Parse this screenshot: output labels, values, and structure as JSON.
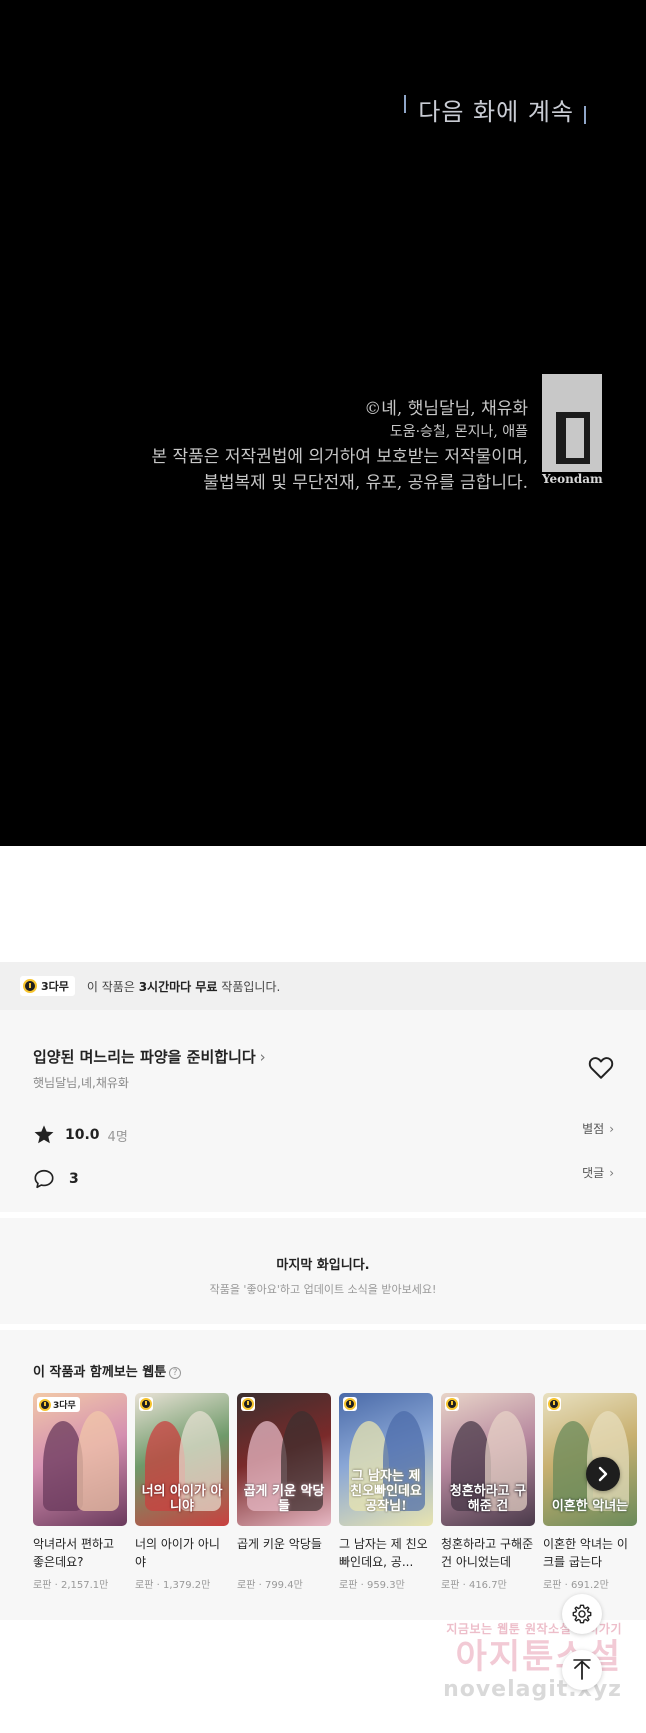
{
  "comic": {
    "to_be_continued": "다음 화에 계속",
    "credit_line1": "©녜, 햇님달님, 채유화",
    "credit_line2": "도움·승칠, 몬지나, 애플",
    "copyright_line1": "본 작품은 저작권법에 의거하여 보호받는 저작물이며,",
    "copyright_line2": "불법복제 및 무단전재, 유포, 공유를 금합니다.",
    "publisher": "Yeondam"
  },
  "free_banner": {
    "badge": "3다무",
    "text_prefix": "이 작품은 ",
    "text_bold": "3시간마다 무료",
    "text_suffix": " 작품입니다."
  },
  "work": {
    "title": "입양된 며느리는 파양을 준비합니다",
    "authors": "햇님달님,녜,채유화",
    "rating": "10.0",
    "rating_count": "4명",
    "rate_label": "별점",
    "comment_count": "3",
    "comment_label": "댓글"
  },
  "last_episode": {
    "title": "마지막 화입니다.",
    "subtitle": "작품을 '좋아요'하고 업데이트 소식을 받아보세요!"
  },
  "recommendations": {
    "heading": "이 작품과 함께보는 웹툰",
    "help": "?",
    "items": [
      {
        "title": "악녀라서 편하고 좋은데요?",
        "genre": "로판",
        "views": "2,157.1만",
        "badge": "3다무",
        "cover_text": "",
        "colors": [
          "#d48fb0",
          "#6a3a5c",
          "#f2c9a8"
        ]
      },
      {
        "title": "너의 아이가 아니야",
        "genre": "로판",
        "views": "1,379.2만",
        "badge": "",
        "cover_text": "너의 아이가 아니야",
        "colors": [
          "#6f9a6a",
          "#c9403f",
          "#e9e2d6"
        ]
      },
      {
        "title": "곱게 키운 악당들",
        "genre": "로판",
        "views": "799.4만",
        "badge": "",
        "cover_text": "곱게 키운 악당들",
        "colors": [
          "#7a2a2a",
          "#e6b8c4",
          "#3b2f2f"
        ]
      },
      {
        "title": "그 남자는 제 친오빠인데요, 공...",
        "genre": "로판",
        "views": "959.3만",
        "badge": "",
        "cover_text": "그 남자는 제 친오빠인데요 공작님!",
        "colors": [
          "#8aa7d6",
          "#e8e4b0",
          "#4a6aa8"
        ]
      },
      {
        "title": "청혼하라고 구해준 건 아니었는데",
        "genre": "로판",
        "views": "416.7만",
        "badge": "",
        "cover_text": "청혼하라고 구해준 건",
        "colors": [
          "#b88aa0",
          "#4a3a4a",
          "#e8d4c8"
        ]
      },
      {
        "title": "이혼한 악녀는 이크를 굽는다",
        "genre": "로판",
        "views": "691.2만",
        "badge": "",
        "cover_text": "이혼한 악녀는",
        "colors": [
          "#c8b070",
          "#6a8a5a",
          "#e8e0c0"
        ]
      }
    ]
  },
  "icons": {
    "favorite": "heart-icon",
    "rating": "star-icon",
    "comments": "comment-bubble-icon",
    "next": "chevron-right-icon",
    "settings": "gear-icon",
    "scroll_top": "arrow-up-icon"
  },
  "watermark": {
    "line1": "지금보는 웹툰 원작소설 보러가기",
    "line2": "아지툰소설",
    "line3": "novelagit.xyz"
  }
}
